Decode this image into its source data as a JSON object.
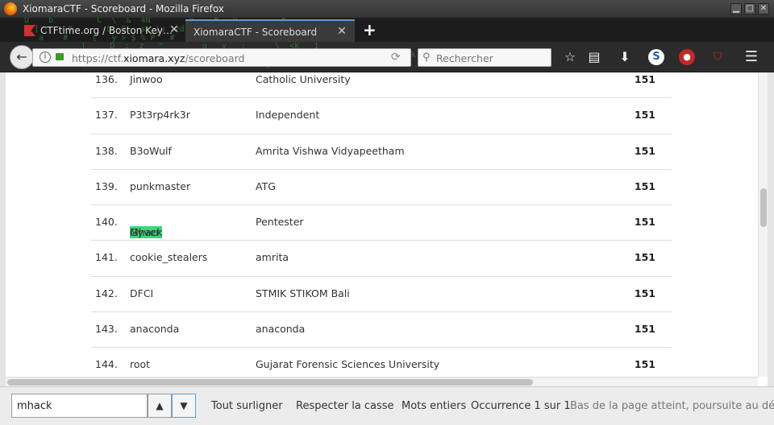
{
  "window": {
    "title": "XiomaraCTF - Scoreboard - Mozilla Firefox",
    "buttons": [
      "▁",
      "□",
      "✕"
    ]
  },
  "tabs": [
    {
      "label": "CTFtime.org / Boston Key…",
      "active": false,
      "icon": "ctftime-favicon"
    },
    {
      "label": "XiomaraCTF - Scoreboard",
      "active": true,
      "icon": ""
    }
  ],
  "newtab_label": "+",
  "navbar": {
    "url_prefix": "https://ctf.",
    "url_domain": "xiomara.xyz",
    "url_path": "/scoreboard",
    "search_placeholder": "Rechercher"
  },
  "scoreboard": {
    "rows": [
      {
        "rank": "136.",
        "name": "Jinwoo",
        "org": "Catholic University",
        "score": "151"
      },
      {
        "rank": "137.",
        "name": "P3t3rp4rk3r",
        "org": "Independent",
        "score": "151"
      },
      {
        "rank": "138.",
        "name": "B3oWulf",
        "org": "Amrita Vishwa Vidyapeetham",
        "score": "151"
      },
      {
        "rank": "139.",
        "name": "punkmaster",
        "org": "ATG",
        "score": "151"
      },
      {
        "rank": "140.",
        "name_hl": "Mhack",
        "name_rest": "Gyver",
        "org": "Pentester",
        "score": "151"
      },
      {
        "rank": "141.",
        "name": "cookie_stealers",
        "org": "amrita",
        "score": "151"
      },
      {
        "rank": "142.",
        "name": "DFCI",
        "org": "STMIK STIKOM Bali",
        "score": "151"
      },
      {
        "rank": "143.",
        "name": "anaconda",
        "org": "anaconda",
        "score": "151"
      },
      {
        "rank": "144.",
        "name": "root",
        "org": "Gujarat Forensic Sciences University",
        "score": "151"
      }
    ]
  },
  "findbar": {
    "query": "mhack",
    "highlight_all": "Tout surligner",
    "highlight_all_key": "o",
    "match_case": "Respecter la casse",
    "whole_words": "Mots entiers",
    "occurrence": "Occurrence 1 sur 1",
    "status": "Bas de la page atteint, poursuite au début"
  },
  "colors": {
    "highlight": "#38d878",
    "matrix": "#2e7d32",
    "chrome_dark": "#2b2b2b"
  }
}
